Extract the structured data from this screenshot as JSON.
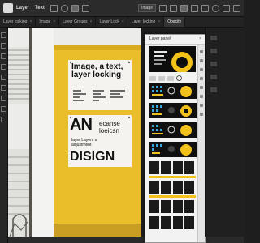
{
  "app": {
    "menu": [
      "Layer",
      "Text"
    ],
    "tool_options": {
      "style_label": "Image",
      "opacity_label": "Opacity"
    }
  },
  "tabs": [
    {
      "label": "Layer locking"
    },
    {
      "label": "Image"
    },
    {
      "label": "Layer Groups"
    },
    {
      "label": "Layer Lock"
    },
    {
      "label": "Layer locking"
    },
    {
      "label": "Opacity",
      "active": true
    }
  ],
  "canvas": {
    "poster_top_text": "Image, a text, layer locking",
    "poster_bottom_big": "AN",
    "poster_bottom_side": "ecanse loeicsn",
    "poster_bottom_small": "layer Layers s adjustment",
    "poster_bottom_footer": "DISIGN"
  },
  "panel": {
    "title": "Layer panel",
    "close_label": "×"
  },
  "colors": {
    "wall_yellow": "#e9be2a",
    "dark_ui": "#1e1e1e",
    "accent": "#f2c21b",
    "panel_bg": "#f2f2f2"
  }
}
